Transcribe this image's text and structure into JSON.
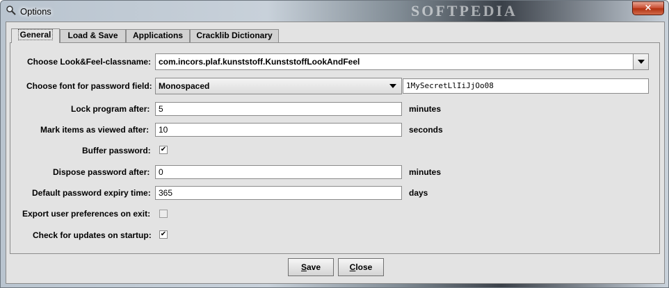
{
  "window": {
    "title": "Options",
    "watermark": "SOFTPEDIA",
    "close_glyph": "×",
    "icon": "magnifier-icon"
  },
  "tabs": [
    {
      "label": "General",
      "active": true
    },
    {
      "label": "Load & Save",
      "active": false
    },
    {
      "label": "Applications",
      "active": false
    },
    {
      "label": "Cracklib Dictionary",
      "active": false
    }
  ],
  "general": {
    "look_and_feel": {
      "label": "Choose Look&Feel-classname:",
      "value": "com.incors.plaf.kunststoff.KunststoffLookAndFeel"
    },
    "password_font": {
      "label": "Choose font for password field:",
      "value": "Monospaced",
      "preview": "1MySecretLlIiJjOo08"
    },
    "lock_program": {
      "label": "Lock program after:",
      "value": "5",
      "unit": "minutes"
    },
    "mark_viewed": {
      "label": "Mark items as viewed after:",
      "value": "10",
      "unit": "seconds"
    },
    "buffer_password": {
      "label": "Buffer password:",
      "checked": true
    },
    "dispose_password": {
      "label": "Dispose password after:",
      "value": "0",
      "unit": "minutes"
    },
    "expiry_time": {
      "label": "Default password expiry time:",
      "value": "365",
      "unit": "days"
    },
    "export_prefs": {
      "label": "Export user preferences on exit:",
      "checked": false
    },
    "check_updates": {
      "label": "Check for updates on startup:",
      "checked": true
    }
  },
  "buttons": {
    "save_mnemonic": "S",
    "save_rest": "ave",
    "close_mnemonic": "C",
    "close_rest": "lose"
  },
  "check_glyph": "✔"
}
